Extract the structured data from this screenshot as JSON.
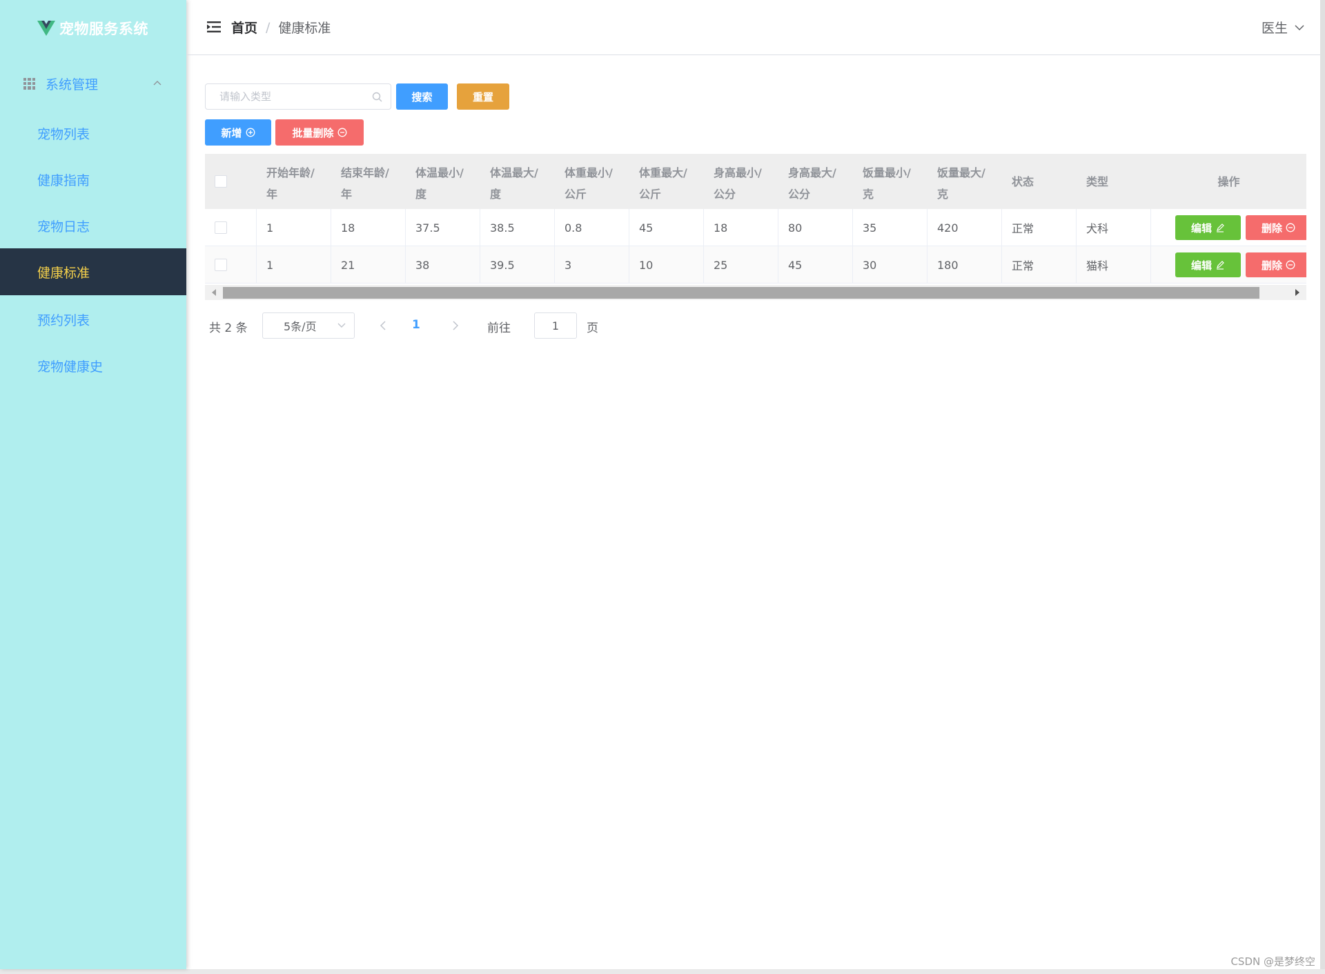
{
  "app": {
    "title": "宠物服务系统"
  },
  "sidebar": {
    "group": {
      "label": "系统管理"
    },
    "items": [
      {
        "label": "宠物列表",
        "active": false
      },
      {
        "label": "健康指南",
        "active": false
      },
      {
        "label": "宠物日志",
        "active": false
      },
      {
        "label": "健康标准",
        "active": true
      },
      {
        "label": "预约列表",
        "active": false
      },
      {
        "label": "宠物健康史",
        "active": false
      }
    ]
  },
  "header": {
    "breadcrumb": {
      "home": "首页",
      "separator": "/",
      "current": "健康标准"
    },
    "user": "医生"
  },
  "toolbar": {
    "search_placeholder": "请输入类型",
    "search_value": "",
    "search_label": "搜索",
    "reset_label": "重置",
    "add_label": "新增",
    "batch_delete_label": "批量删除"
  },
  "table": {
    "headers": {
      "age_min": [
        "开始年龄/",
        "年"
      ],
      "age_max": [
        "结束年龄/",
        "年"
      ],
      "temp_min": [
        "体温最小/",
        "度"
      ],
      "temp_max": [
        "体温最大/",
        "度"
      ],
      "weight_min": [
        "体重最小/",
        "公斤"
      ],
      "weight_max": [
        "体重最大/",
        "公斤"
      ],
      "height_min": [
        "身高最小/",
        "公分"
      ],
      "height_max": [
        "身高最大/",
        "公分"
      ],
      "food_min": [
        "饭量最小/",
        "克"
      ],
      "food_max": [
        "饭量最大/",
        "克"
      ],
      "status": "状态",
      "type": "类型",
      "actions": "操作"
    },
    "rows": [
      {
        "age_min": "1",
        "age_max": "18",
        "temp_min": "37.5",
        "temp_max": "38.5",
        "weight_min": "0.8",
        "weight_max": "45",
        "height_min": "18",
        "height_max": "80",
        "food_min": "35",
        "food_max": "420",
        "status": "正常",
        "type": "犬科"
      },
      {
        "age_min": "1",
        "age_max": "21",
        "temp_min": "38",
        "temp_max": "39.5",
        "weight_min": "3",
        "weight_max": "10",
        "height_min": "25",
        "height_max": "45",
        "food_min": "30",
        "food_max": "180",
        "status": "正常",
        "type": "猫科"
      }
    ],
    "edit_label": "编辑",
    "delete_label": "删除"
  },
  "pagination": {
    "total_text": "共 2 条",
    "page_size": "5条/页",
    "current_page": "1",
    "goto_label": "前往",
    "goto_value": "1",
    "goto_unit": "页"
  },
  "watermark": "CSDN @是梦终空",
  "colors": {
    "sidebar_bg": "#b0eeee",
    "active_bg": "#263445",
    "active_text": "#f5d14b",
    "primary": "#409eff",
    "success": "#67c23a",
    "warning": "#e6a23c",
    "danger": "#f56c6c"
  }
}
